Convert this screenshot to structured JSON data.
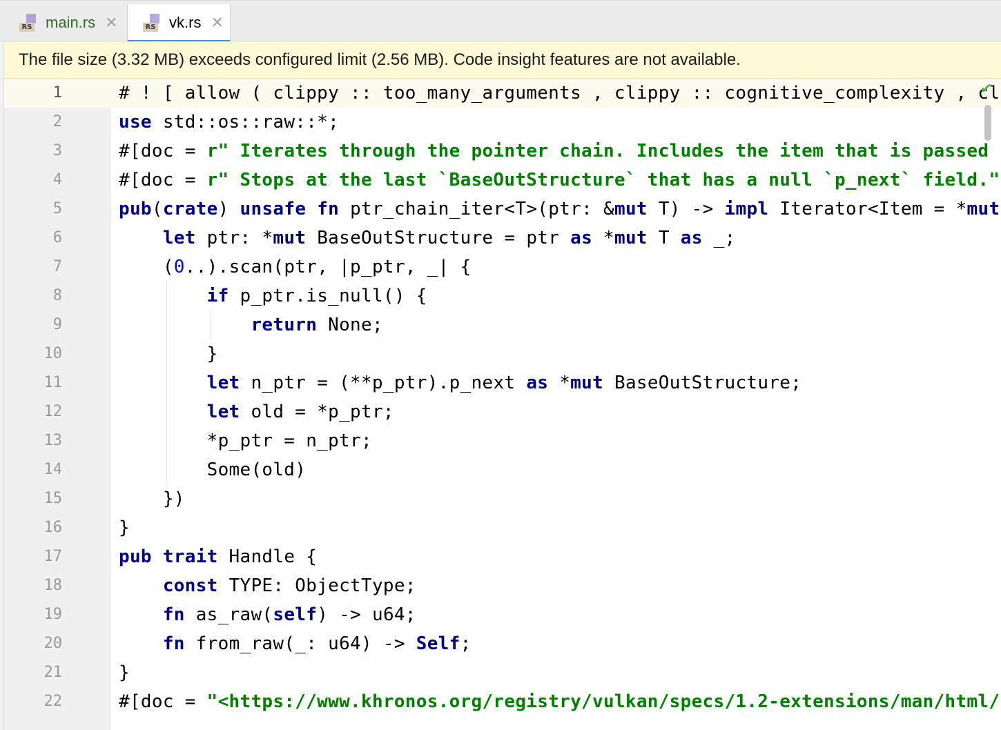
{
  "tabs": [
    {
      "icon": "rust-file-icon",
      "icon_text": "RS",
      "name": "main.rs",
      "close": "✕"
    },
    {
      "icon": "rust-file-icon",
      "icon_text": "RS",
      "name": "vk.rs",
      "close": "✕"
    }
  ],
  "banner": {
    "text": "The file size (3.32 MB) exceeds configured limit (2.56 MB). Code insight features are not available."
  },
  "status": {
    "inspection_icon": "check-icon",
    "glyph": "✔"
  },
  "colors": {
    "keyword": "#000080",
    "string": "#008000",
    "number": "#0000ff",
    "banner_bg": "#fcf9d6",
    "active_tab_underline": "#4a88c7"
  },
  "editor": {
    "lines": [
      {
        "n": "1",
        "t": [
          [
            "p",
            "# ! [ allow ( clippy :: too_many_arguments , clippy :: cognitive_complexity , cl"
          ]
        ]
      },
      {
        "n": "2",
        "t": [
          [
            "k",
            "use"
          ],
          [
            "p",
            " std::os::raw::*;"
          ]
        ]
      },
      {
        "n": "3",
        "t": [
          [
            "p",
            "#[doc = "
          ],
          [
            "s",
            "r\" Iterates through the pointer chain. Includes the item that is passed"
          ]
        ]
      },
      {
        "n": "4",
        "t": [
          [
            "p",
            "#[doc = "
          ],
          [
            "s",
            "r\" Stops at the last `BaseOutStructure` that has a null `p_next` field.\""
          ]
        ]
      },
      {
        "n": "5",
        "t": [
          [
            "k",
            "pub"
          ],
          [
            "p",
            "("
          ],
          [
            "k",
            "crate"
          ],
          [
            "p",
            ") "
          ],
          [
            "k",
            "unsafe fn"
          ],
          [
            "p",
            " ptr_chain_iter<T>(ptr: &"
          ],
          [
            "k",
            "mut"
          ],
          [
            "p",
            " T) -> "
          ],
          [
            "k",
            "impl"
          ],
          [
            "p",
            " Iterator<Item = *"
          ],
          [
            "k",
            "mut"
          ]
        ]
      },
      {
        "n": "6",
        "t": [
          [
            "p",
            "    "
          ],
          [
            "k",
            "let"
          ],
          [
            "p",
            " ptr: *"
          ],
          [
            "k",
            "mut"
          ],
          [
            "p",
            " BaseOutStructure = ptr "
          ],
          [
            "k",
            "as"
          ],
          [
            "p",
            " *"
          ],
          [
            "k",
            "mut"
          ],
          [
            "p",
            " T "
          ],
          [
            "k",
            "as"
          ],
          [
            "p",
            " _;"
          ]
        ]
      },
      {
        "n": "7",
        "t": [
          [
            "p",
            "    ("
          ],
          [
            "n",
            "0"
          ],
          [
            "p",
            "..).scan(ptr, |p_ptr, _| {"
          ]
        ]
      },
      {
        "n": "8",
        "t": [
          [
            "p",
            "        "
          ],
          [
            "k",
            "if"
          ],
          [
            "p",
            " p_ptr.is_null() {"
          ]
        ]
      },
      {
        "n": "9",
        "t": [
          [
            "p",
            "            "
          ],
          [
            "k",
            "return"
          ],
          [
            "p",
            " None;"
          ]
        ]
      },
      {
        "n": "10",
        "t": [
          [
            "p",
            "        }"
          ]
        ]
      },
      {
        "n": "11",
        "t": [
          [
            "p",
            "        "
          ],
          [
            "k",
            "let"
          ],
          [
            "p",
            " n_ptr = (**p_ptr).p_next "
          ],
          [
            "k",
            "as"
          ],
          [
            "p",
            " *"
          ],
          [
            "k",
            "mut"
          ],
          [
            "p",
            " BaseOutStructure;"
          ]
        ]
      },
      {
        "n": "12",
        "t": [
          [
            "p",
            "        "
          ],
          [
            "k",
            "let"
          ],
          [
            "p",
            " old = *p_ptr;"
          ]
        ]
      },
      {
        "n": "13",
        "t": [
          [
            "p",
            "        *p_ptr = n_ptr;"
          ]
        ]
      },
      {
        "n": "14",
        "t": [
          [
            "p",
            "        Some(old)"
          ]
        ]
      },
      {
        "n": "15",
        "t": [
          [
            "p",
            "    })"
          ]
        ]
      },
      {
        "n": "16",
        "t": [
          [
            "p",
            "}"
          ]
        ]
      },
      {
        "n": "17",
        "t": [
          [
            "k",
            "pub trait"
          ],
          [
            "p",
            " Handle {"
          ]
        ]
      },
      {
        "n": "18",
        "t": [
          [
            "p",
            "    "
          ],
          [
            "k",
            "const"
          ],
          [
            "p",
            " TYPE: ObjectType;"
          ]
        ]
      },
      {
        "n": "19",
        "t": [
          [
            "p",
            "    "
          ],
          [
            "k",
            "fn"
          ],
          [
            "p",
            " as_raw("
          ],
          [
            "k",
            "self"
          ],
          [
            "p",
            ") -> u64;"
          ]
        ]
      },
      {
        "n": "20",
        "t": [
          [
            "p",
            "    "
          ],
          [
            "k",
            "fn"
          ],
          [
            "p",
            " from_raw(_: u64) -> "
          ],
          [
            "k",
            "Self"
          ],
          [
            "p",
            ";"
          ]
        ]
      },
      {
        "n": "21",
        "t": [
          [
            "p",
            "}"
          ]
        ]
      },
      {
        "n": "22",
        "t": [
          [
            "p",
            "#[doc = "
          ],
          [
            "s",
            "\"<https://www.khronos.org/registry/vulkan/specs/1.2-extensions/man/html/"
          ]
        ]
      }
    ]
  }
}
